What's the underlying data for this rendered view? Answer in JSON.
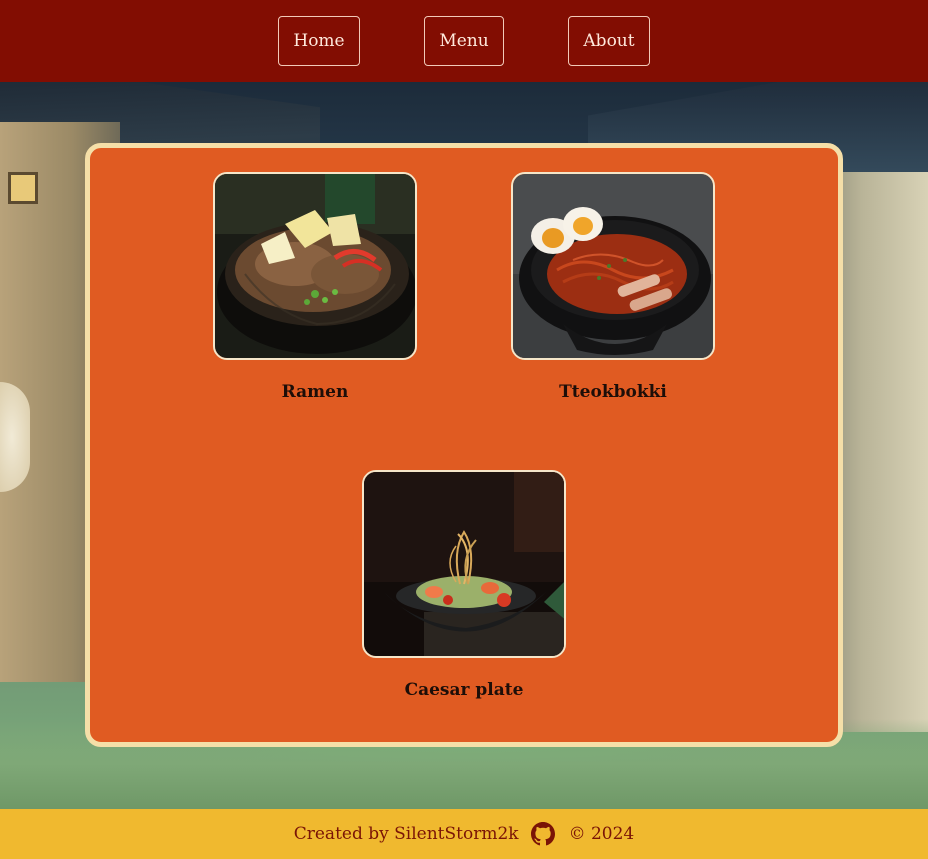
{
  "nav": {
    "home_label": "Home",
    "menu_label": "Menu",
    "about_label": "About"
  },
  "dishes": [
    {
      "name": "Ramen"
    },
    {
      "name": "Tteokbokki"
    },
    {
      "name": "Caesar plate"
    }
  ],
  "footer": {
    "created_by": "Created by SilentStorm2k",
    "copyright": "© 2024",
    "icon": "github-icon"
  },
  "colors": {
    "header_bg": "#820d02",
    "card_bg": "#e05b22",
    "card_border": "#f5dfa8",
    "footer_bg": "#f0b92f",
    "footer_text": "#7a1406"
  }
}
